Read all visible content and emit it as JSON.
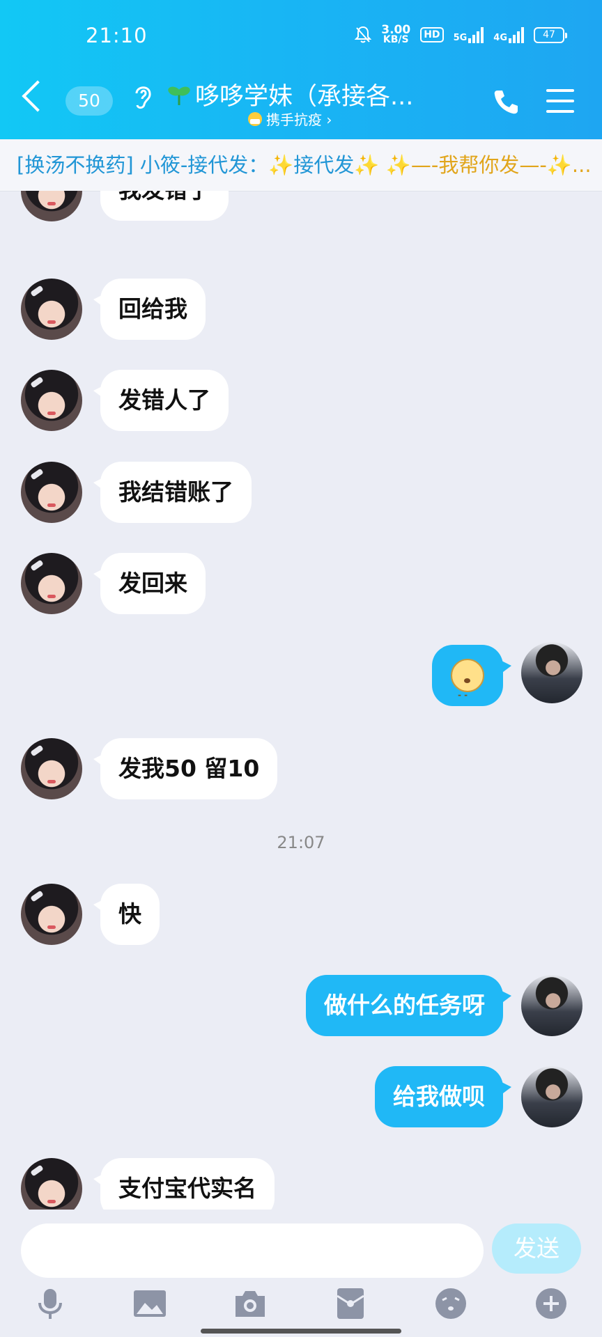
{
  "status_bar": {
    "time": "21:10",
    "speed_value": "3.00",
    "speed_unit": "KB/S",
    "hd": "HD",
    "net1": "5G",
    "net2": "4G",
    "battery": "47"
  },
  "header": {
    "unread_count": "50",
    "title": "哆哆学妹（承接各...",
    "subtitle": "携手抗疫 ›"
  },
  "notice": {
    "part1": "[换汤不换药] 小筱-接代发：✨接代发✨",
    "part2": "  ✨—-我帮你发—-✨..."
  },
  "messages": [
    {
      "side": "in",
      "text": "我发错了"
    },
    {
      "side": "in",
      "text": "回给我"
    },
    {
      "side": "in",
      "text": "发错人了"
    },
    {
      "side": "in",
      "text": "我结错账了"
    },
    {
      "side": "in",
      "text": "发回来"
    },
    {
      "side": "out",
      "type": "emoji",
      "emoji": "dizzy-face-emoji"
    },
    {
      "side": "in",
      "text": "发我50 留10"
    },
    {
      "timestamp": "21:07"
    },
    {
      "side": "in",
      "text": "快"
    },
    {
      "side": "out",
      "text": "做什么的任务呀"
    },
    {
      "side": "out",
      "text": "给我做呗"
    },
    {
      "side": "in",
      "text": "支付宝代实名"
    }
  ],
  "input": {
    "placeholder": "",
    "send_label": "发送"
  },
  "toolbar_icons": [
    "microphone-icon",
    "image-icon",
    "camera-icon",
    "red-packet-icon",
    "emoji-icon",
    "plus-icon"
  ],
  "colors": {
    "header_gradient_start": "#12c8f5",
    "header_gradient_end": "#1ea6f2",
    "outgoing_bubble": "#20b8f6",
    "background": "#ebedf5",
    "send_button_disabled": "#b5ecfc"
  }
}
